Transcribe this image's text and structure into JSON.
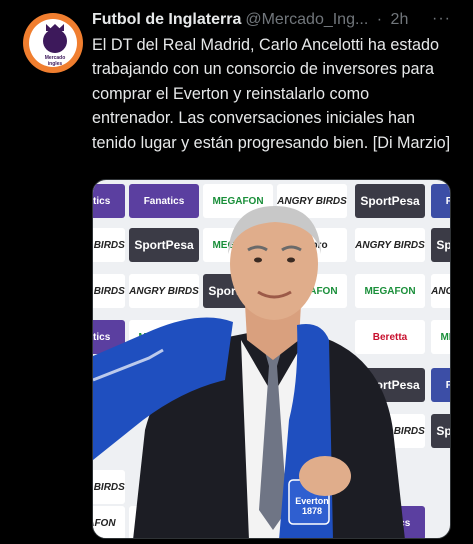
{
  "tweet": {
    "author_name": "Futbol de Inglaterra",
    "author_handle": "@Mercado_Ing...",
    "separator": "·",
    "time": "2h",
    "more_icon": "more-dots-icon",
    "text": "El DT del Real Madrid, Carlo Ancelotti ha estado trabajando con un consorcio de inversores para comprar el Everton y reinstalarlo como entrenador. Las conversaciones iniciales han tenido lugar y están progresando bien. [Di Marzio]"
  },
  "avatar": {
    "ring_text": "Mercado ingles",
    "colors": {
      "ring": "#f07e2f",
      "lion": "#3d195b"
    }
  },
  "media": {
    "backdrop_sponsors": {
      "fanatics": "Fanatics",
      "megafon": "MEGAFON",
      "angry_birds": "ANGRY BIRDS",
      "sportpesa": "SportPesa",
      "umbro": "umbro",
      "beretta": "Beretta",
      "everton_badge": "Everton 1878"
    },
    "colors": {
      "scarf": "#1f4fbf",
      "suit": "#1c1d24",
      "backdrop": "#eef0f3"
    }
  }
}
